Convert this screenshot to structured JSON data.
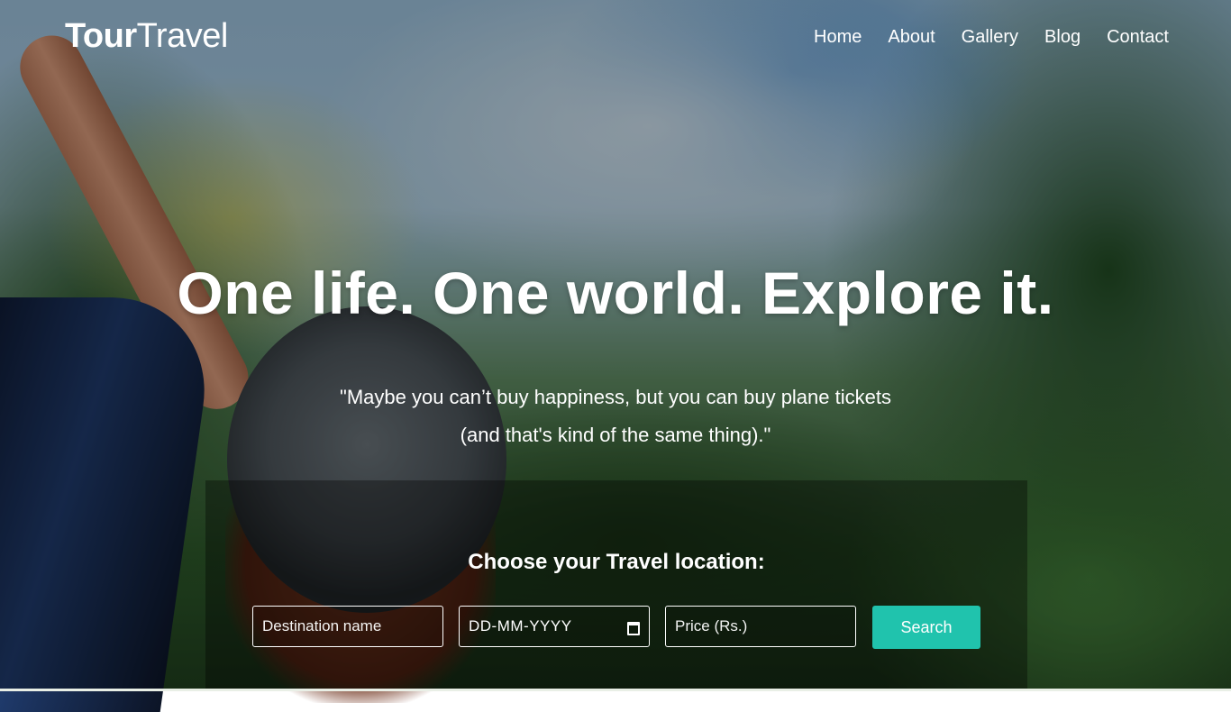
{
  "header": {
    "logo_bold": "Tour",
    "logo_light": "Travel",
    "nav": [
      "Home",
      "About",
      "Gallery",
      "Blog",
      "Contact"
    ]
  },
  "hero": {
    "headline": "One life. One world. Explore it.",
    "quote_line1": "\"Maybe you can’t buy happiness, but you can buy plane tickets",
    "quote_line2": "(and that's kind of the same thing).\""
  },
  "search": {
    "title": "Choose your Travel location:",
    "destination_placeholder": "Destination name",
    "date_placeholder": "DD-MM-YYYY",
    "price_placeholder": "Price (Rs.)",
    "button_label": "Search"
  },
  "colors": {
    "accent": "#20c3ad",
    "text": "#ffffff"
  },
  "icons": {
    "date_field": "calendar-icon"
  }
}
